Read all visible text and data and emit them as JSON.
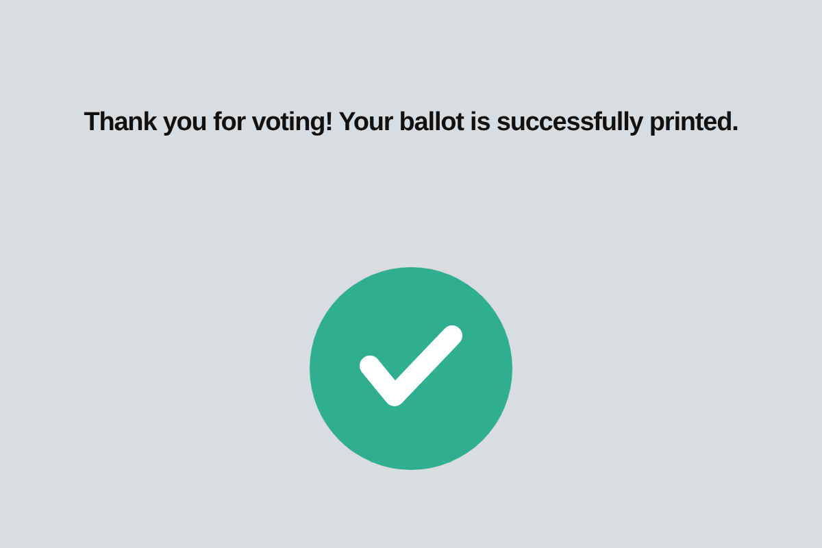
{
  "message": "Thank you for voting! Your ballot is successfully printed."
}
